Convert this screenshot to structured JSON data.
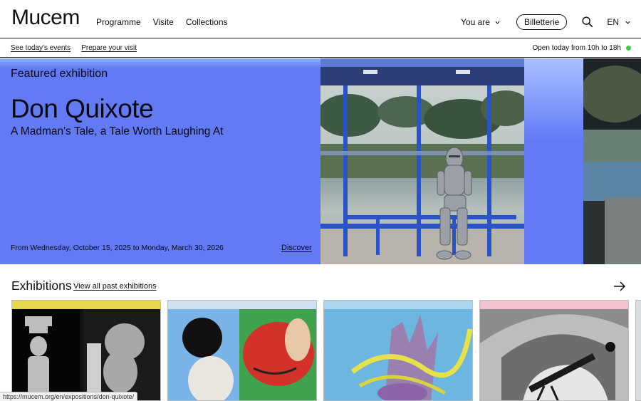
{
  "header": {
    "logo": "Mucem",
    "nav": [
      "Programme",
      "Visite",
      "Collections"
    ],
    "you_are": "You are",
    "billetterie": "Billetterie",
    "lang": "EN"
  },
  "subbar": {
    "links": [
      "See today's events",
      "Prepare your visit"
    ],
    "open_today": "Open today from 10h to 18h",
    "open_color": "#3ccc45"
  },
  "hero": {
    "label": "Featured exhibition",
    "title": "Don Quixote",
    "subtitle": "A Madman's Tale, a Tale Worth Laughing At",
    "dates": "From Wednesday, October 15, 2025 to Monday, March 30, 2026",
    "discover": "Discover",
    "bg_color": "#627bf5"
  },
  "exhibitions": {
    "title": "Exhibitions",
    "past_link": "View all past exhibitions"
  },
  "status_url": "https://mucem.org/en/expositions/don-quixote/"
}
